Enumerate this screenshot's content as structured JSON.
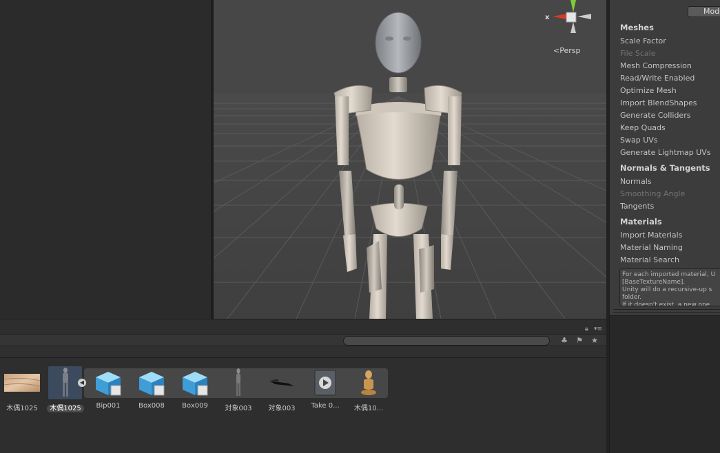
{
  "scene": {
    "persp_label": "Persp",
    "gizmo_axis_label": "x"
  },
  "inspector": {
    "mode_button_label": "Model",
    "sections": [
      {
        "header": "Meshes",
        "items": [
          {
            "label": "Scale Factor",
            "disabled": false
          },
          {
            "label": "File Scale",
            "disabled": true
          },
          {
            "label": "Mesh Compression",
            "disabled": false
          },
          {
            "label": "Read/Write Enabled",
            "disabled": false
          },
          {
            "label": "Optimize Mesh",
            "disabled": false
          },
          {
            "label": "Import BlendShapes",
            "disabled": false
          },
          {
            "label": "Generate Colliders",
            "disabled": false
          },
          {
            "label": "Keep Quads",
            "disabled": false
          },
          {
            "label": "Swap UVs",
            "disabled": false
          },
          {
            "label": "Generate Lightmap UVs",
            "disabled": false
          }
        ]
      },
      {
        "header": "Normals & Tangents",
        "items": [
          {
            "label": "Normals",
            "disabled": false
          },
          {
            "label": "Smoothing Angle",
            "disabled": true
          },
          {
            "label": "Tangents",
            "disabled": false
          }
        ]
      },
      {
        "header": "Materials",
        "items": [
          {
            "label": "Import Materials",
            "disabled": false
          },
          {
            "label": "Material Naming",
            "disabled": false
          },
          {
            "label": "Material Search",
            "disabled": false
          }
        ]
      }
    ],
    "help_text": "For each imported material, U\n[BaseTextureName].\nUnity will do a recursive-up s\nfolder.\nIf it doesn't exist, a new one"
  },
  "project": {
    "search_placeholder": "",
    "assets": [
      {
        "label": "木偶1025",
        "kind": "texture",
        "selected": false
      },
      {
        "label": "木偶1025",
        "kind": "model-prefab",
        "selected": true
      },
      {
        "label": "Bip001",
        "kind": "cube-mesh",
        "selected": false
      },
      {
        "label": "Box008",
        "kind": "cube-mesh",
        "selected": false
      },
      {
        "label": "Box009",
        "kind": "cube-mesh",
        "selected": false
      },
      {
        "label": "対象003",
        "kind": "figure-mesh",
        "selected": false
      },
      {
        "label": "対象003",
        "kind": "flat-mesh",
        "selected": false
      },
      {
        "label": "Take 0...",
        "kind": "animation-clip",
        "selected": false
      },
      {
        "label": "木偶10...",
        "kind": "avatar",
        "selected": false
      }
    ]
  }
}
